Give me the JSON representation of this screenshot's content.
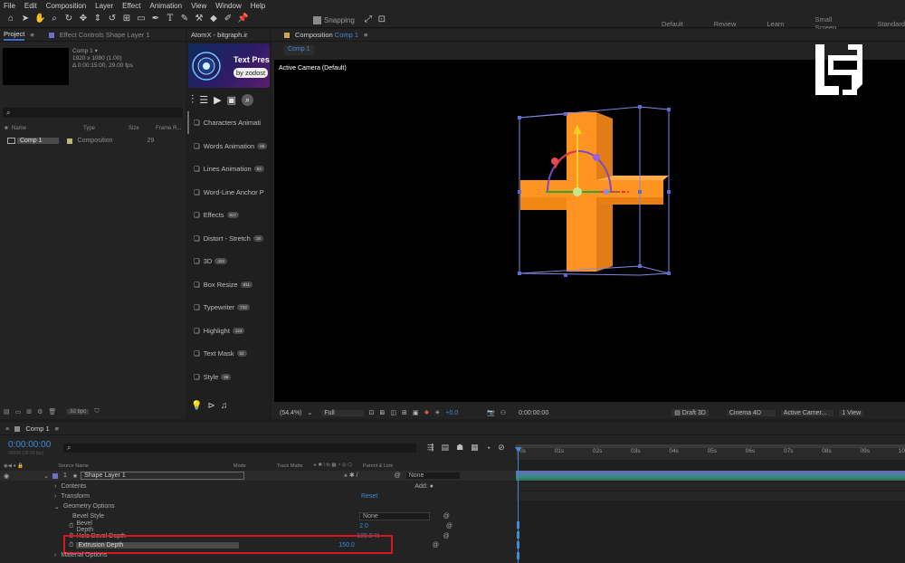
{
  "menu": [
    "File",
    "Edit",
    "Composition",
    "Layer",
    "Effect",
    "Animation",
    "View",
    "Window",
    "Help"
  ],
  "toolbar": {
    "snapping": "Snapping",
    "workspaces": [
      "Default",
      "Review",
      "Learn",
      "Small Screen",
      "Standard"
    ]
  },
  "project": {
    "tab_project": "Project",
    "tab_effect_controls": "Effect Controls Shape Layer 1",
    "comp_name": "Comp 1 ▾",
    "comp_res": "1920 x 1080 (1.00)",
    "comp_duration": "Δ 0:00:15:00, 29.00 fps",
    "columns": [
      "Name",
      "Type",
      "Size",
      "Frame R..."
    ],
    "rows": [
      {
        "name": "Comp 1",
        "type": "Composition",
        "size": "",
        "fps": "29"
      }
    ],
    "bpc": "32 bpc"
  },
  "atomx": {
    "title": "AtomX - bitgraph.ir",
    "banner_title": "Text Pres",
    "banner_sub": "by zodost",
    "items": [
      {
        "label": "Characters Animati",
        "badge": ""
      },
      {
        "label": "Words Animation",
        "badge": "66"
      },
      {
        "label": "Lines Animation",
        "badge": "54"
      },
      {
        "label": "Word-Line Anchor P",
        "badge": ""
      },
      {
        "label": "Effects",
        "badge": "817"
      },
      {
        "label": "Distort - Stretch",
        "badge": "19"
      },
      {
        "label": "3D",
        "badge": "333"
      },
      {
        "label": "Box Resize",
        "badge": "911"
      },
      {
        "label": "Typewriter",
        "badge": "732"
      },
      {
        "label": "Highlight",
        "badge": "123"
      },
      {
        "label": "Text Mask",
        "badge": "22"
      },
      {
        "label": "Style",
        "badge": "68"
      }
    ]
  },
  "composition": {
    "tab_label": "Composition",
    "tab_comp": "Comp 1",
    "sub_tab": "Comp 1",
    "camera_label": "Active Camera (Default)",
    "zoom": "(54.4%)",
    "resolution": "Full",
    "exposure": "+0.0",
    "timecode": "0:00:00:00",
    "draft3d": "Draft 3D",
    "renderer": "Cinema 4D",
    "camera": "Active Camer...",
    "views": "1 View"
  },
  "timeline": {
    "tab": "Comp 1",
    "timecode": "0:00:00:00",
    "timecode_sub": "00000 (29.00 fps)",
    "col_source": "Source Name",
    "col_mode": "Mode",
    "col_matte": "Track Matte",
    "col_parent": "Parent & Link",
    "layer_num": "1",
    "layer_name": "Shape Layer 1",
    "parent": "None",
    "contents": "Contents",
    "add": "Add:",
    "transform": "Transform",
    "reset": "Reset",
    "geometry": "Geometry Options",
    "bevel_style": "Bevel Style",
    "bevel_style_val": "None",
    "bevel_depth": "Bevel Depth",
    "bevel_depth_val": "2.0",
    "hole_bevel": "Hole Bevel Depth",
    "hole_bevel_val": "100.0 %",
    "extrusion": "Extrusion Depth",
    "extrusion_val": "150.0",
    "material": "Material Options",
    "ruler": [
      "0s",
      "01s",
      "02s",
      "03s",
      "04s",
      "05s",
      "06s",
      "07s",
      "08s",
      "09s",
      "10"
    ]
  },
  "colors": {
    "accent": "#3b6ecf",
    "orange": "#ff9422",
    "highlight": "#d8161d",
    "timecode": "#3f8bd8"
  }
}
